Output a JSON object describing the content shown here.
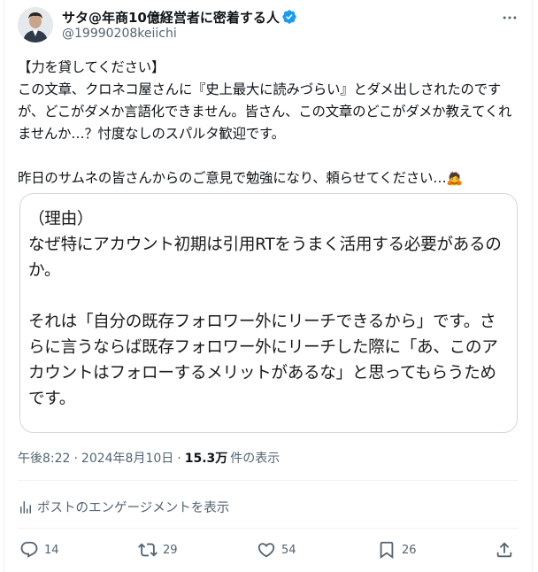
{
  "author": {
    "display_name": "サタ@年商10億経営者に密着する人",
    "handle": "@19990208keiichi",
    "verified": true,
    "avatar": "avatar-photo"
  },
  "tweet": {
    "text": "【力を貸してください】\nこの文章、クロネコ屋さんに『史上最大に読みづらい』とダメ出しされたのですが、どこがダメか言語化できません。皆さん、この文章のどこがダメか教えてくれませんか…？忖度なしのスパルタ歓迎です。\n\n昨日のサムネの皆さんからのご意見で勉強になり、頼らせてください…🙇"
  },
  "card": {
    "text": "（理由）\nなぜ特にアカウント初期は引用RTをうまく活用する必要があるのか。\n\nそれは「自分の既存フォロワー外にリーチできるから」です。さらに言うならば既存フォロワー外にリーチした際に「あ、このアカウントはフォローするメリットがあるな」と思ってもらうためです。"
  },
  "meta": {
    "time": "午後8:22",
    "date": "2024年8月10日",
    "separator": "·",
    "views": "15.3万",
    "views_label": "件の表示"
  },
  "engagements": {
    "label": "ポストのエンゲージメントを表示"
  },
  "actions": {
    "replies": "14",
    "reposts": "29",
    "likes": "54",
    "bookmarks": "26"
  },
  "colors": {
    "text": "#0f1419",
    "secondary": "#536471",
    "verified": "#1d9bf0",
    "border": "#cfd9de",
    "divider": "#eff3f4"
  },
  "icons": [
    "verified-badge-icon",
    "more-icon",
    "analytics-icon",
    "reply-icon",
    "repost-icon",
    "like-icon",
    "bookmark-icon",
    "share-icon"
  ]
}
